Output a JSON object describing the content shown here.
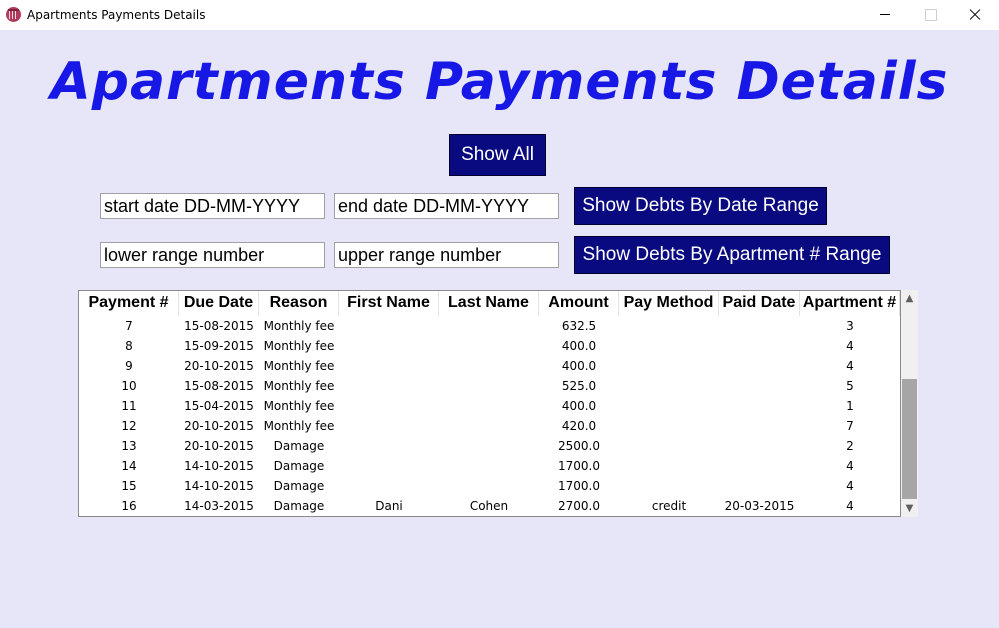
{
  "window": {
    "title": "Apartments Payments Details"
  },
  "header": {
    "title": "Apartments Payments Details"
  },
  "buttons": {
    "show_all": "Show All",
    "show_by_date": "Show Debts By Date Range",
    "show_by_apartment": "Show Debts By Apartment # Range"
  },
  "inputs": {
    "start_date": "start date DD-MM-YYYY",
    "end_date": "end date DD-MM-YYYY",
    "lower_range": "lower range number",
    "upper_range": "upper range number"
  },
  "table": {
    "columns": [
      "Payment #",
      "Due Date",
      "Reason",
      "First Name",
      "Last Name",
      "Amount",
      "Pay Method",
      "Paid Date",
      "Apartment #"
    ],
    "rows": [
      [
        "7",
        "15-08-2015",
        "Monthly fee",
        "",
        "",
        "632.5",
        "",
        "",
        "3"
      ],
      [
        "8",
        "15-09-2015",
        "Monthly fee",
        "",
        "",
        "400.0",
        "",
        "",
        "4"
      ],
      [
        "9",
        "20-10-2015",
        "Monthly fee",
        "",
        "",
        "400.0",
        "",
        "",
        "4"
      ],
      [
        "10",
        "15-08-2015",
        "Monthly fee",
        "",
        "",
        "525.0",
        "",
        "",
        "5"
      ],
      [
        "11",
        "15-04-2015",
        "Monthly fee",
        "",
        "",
        "400.0",
        "",
        "",
        "1"
      ],
      [
        "12",
        "20-10-2015",
        "Monthly fee",
        "",
        "",
        "420.0",
        "",
        "",
        "7"
      ],
      [
        "13",
        "20-10-2015",
        "Damage",
        "",
        "",
        "2500.0",
        "",
        "",
        "2"
      ],
      [
        "14",
        "14-10-2015",
        "Damage",
        "",
        "",
        "1700.0",
        "",
        "",
        "4"
      ],
      [
        "15",
        "14-10-2015",
        "Damage",
        "",
        "",
        "1700.0",
        "",
        "",
        "4"
      ],
      [
        "16",
        "14-03-2015",
        "Damage",
        "Dani",
        "Cohen",
        "2700.0",
        "credit",
        "20-03-2015",
        "4"
      ]
    ]
  },
  "icons": {
    "app": "app-icon",
    "minimize": "minimize-icon",
    "maximize": "maximize-icon",
    "close": "close-icon",
    "scroll_up": "chevron-up-icon",
    "scroll_down": "chevron-down-icon"
  },
  "colors": {
    "background": "#e6e6f8",
    "title": "#1818e6",
    "button": "#0a0a80"
  }
}
